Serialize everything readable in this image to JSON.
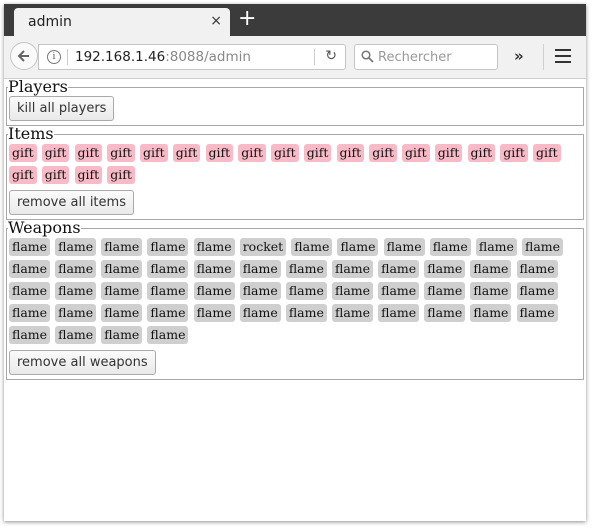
{
  "browser": {
    "tab_title": "admin",
    "close_glyph": "×",
    "new_tab_glyph": "+",
    "url_host": "192.168.1.46",
    "url_rest": ":8088/admin",
    "search_placeholder": "Rechercher",
    "overflow_glyph": "»",
    "reload_glyph": "↻",
    "info_glyph": "i"
  },
  "players": {
    "legend": "Players",
    "kill_button": "kill all players"
  },
  "items": {
    "legend": "Items",
    "list": [
      "gift",
      "gift",
      "gift",
      "gift",
      "gift",
      "gift",
      "gift",
      "gift",
      "gift",
      "gift",
      "gift",
      "gift",
      "gift",
      "gift",
      "gift",
      "gift",
      "gift",
      "gift",
      "gift",
      "gift",
      "gift"
    ],
    "remove_button": "remove all items"
  },
  "weapons": {
    "legend": "Weapons",
    "list": [
      "flame",
      "flame",
      "flame",
      "flame",
      "flame",
      "rocket",
      "flame",
      "flame",
      "flame",
      "flame",
      "flame",
      "flame",
      "flame",
      "flame",
      "flame",
      "flame",
      "flame",
      "flame",
      "flame",
      "flame",
      "flame",
      "flame",
      "flame",
      "flame",
      "flame",
      "flame",
      "flame",
      "flame",
      "flame",
      "flame",
      "flame",
      "flame",
      "flame",
      "flame",
      "flame",
      "flame",
      "flame",
      "flame",
      "flame",
      "flame",
      "flame",
      "flame",
      "flame",
      "flame",
      "flame",
      "flame",
      "flame",
      "flame",
      "flame",
      "flame",
      "flame",
      "flame"
    ],
    "remove_button": "remove all weapons"
  },
  "colors": {
    "item_chip": "#f8bac7",
    "weapon_chip": "#cfcfcf",
    "tabstrip": "#3b3b3b"
  }
}
